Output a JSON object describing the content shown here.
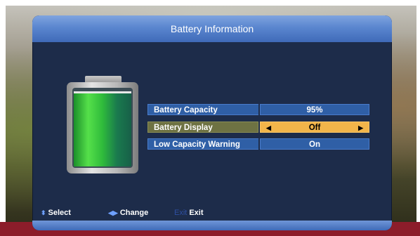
{
  "dialog": {
    "title": "Battery Information"
  },
  "battery": {
    "level": 0.95
  },
  "rows": [
    {
      "label": "Battery Capacity",
      "value": "95%"
    },
    {
      "label": "Battery Display",
      "value": "Off"
    },
    {
      "label": "Low Capacity Warning",
      "value": "On"
    }
  ],
  "footer": {
    "select_label": "Select",
    "change_label": "Change",
    "exit_key": "Exit",
    "exit_label": "Exit"
  },
  "icons": {
    "select": "up-down-arrows-icon",
    "change": "left-right-arrows-icon",
    "left": "left-arrow-icon",
    "right": "right-arrow-icon"
  },
  "colors": {
    "title_bar": "#5a86cf",
    "panel": "#1d2c4a",
    "row_normal": "#2f5fa6",
    "row_selected_value": "#f2b54a",
    "row_selected_label": "#6e7243",
    "battery_green": "#55e04a"
  }
}
